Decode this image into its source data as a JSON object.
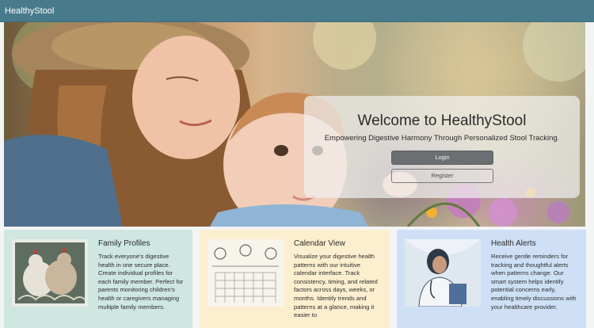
{
  "navbar": {
    "brand": "HealthyStool"
  },
  "hero": {
    "title": "Welcome to HealthyStool",
    "subtitle": "Empowering Digestive Harmony Through Personalized Stool Tracking.",
    "login_label": "Login",
    "register_label": "Register"
  },
  "features": [
    {
      "title": "Family Profiles",
      "description": "Track everyone's digestive health in one secure place. Create individual profiles for each family member. Perfect for parents monitoring children's health or caregivers managing multiple family members.",
      "image_icon": "chickens-illustration-icon",
      "background": "#cfe6e1"
    },
    {
      "title": "Calendar View",
      "description": "Visualize your digestive health patterns with our intuitive calendar interface. Track consistency, timing, and related factors across days, weeks, or months. Identify trends and patterns at a glance, making it easier to",
      "image_icon": "calendar-illustration-icon",
      "background": "#fcefcf"
    },
    {
      "title": "Health Alerts",
      "description": "Receive gentle reminders for tracking and thoughtful alerts when patterns change. Our smart system helps identify potential concerns early, enabling timely discussions with your healthcare provider.",
      "image_icon": "doctor-illustration-icon",
      "background": "#cfe0f6"
    }
  ]
}
